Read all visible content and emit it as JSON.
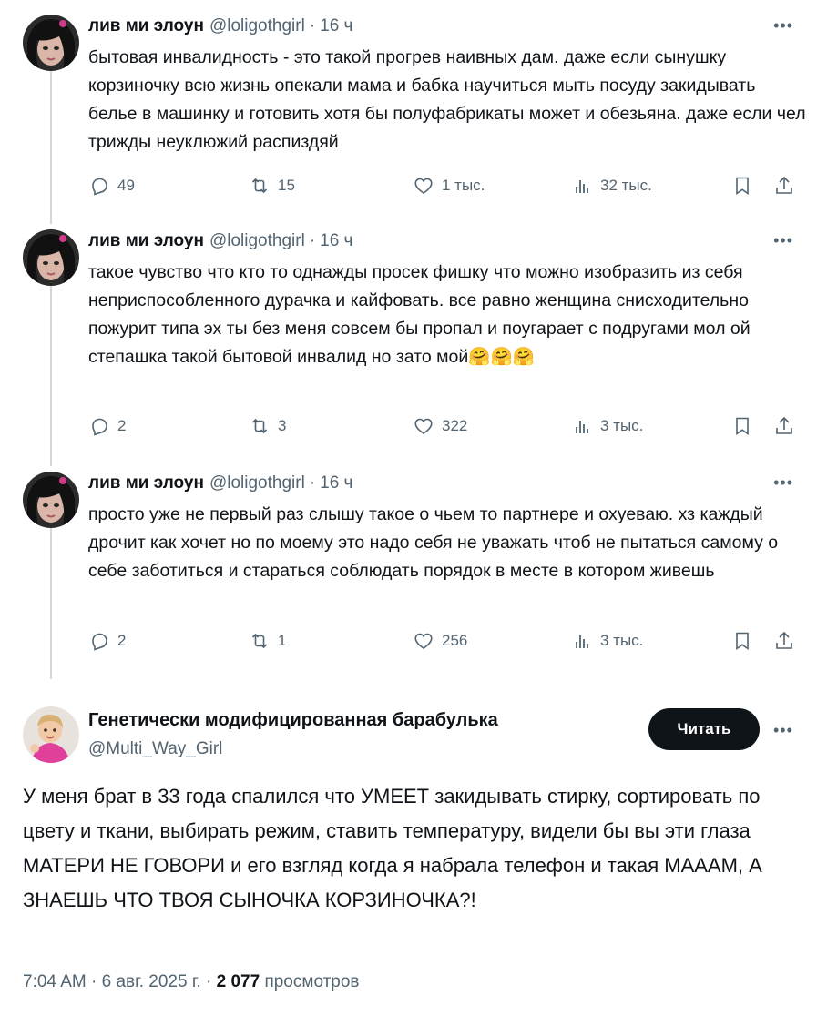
{
  "thread": [
    {
      "name": "лив ми элоун",
      "handle": "@loligothgirl",
      "sep": "·",
      "time": "16 ч",
      "text": "бытовая инвалидность - это такой прогрев наивных дам. даже если сынушку корзиночку всю жизнь опекали мама и бабка научиться мыть посуду закидывать белье в машинку и готовить хотя бы полуфабрикаты может и обезьяна. даже если чел трижды неуклюжий распиздяй",
      "replies": "49",
      "reposts": "15",
      "likes": "1 тыс.",
      "views": "32 тыс."
    },
    {
      "name": "лив ми элоун",
      "handle": "@loligothgirl",
      "sep": "·",
      "time": "16 ч",
      "text": "такое чувство что кто то однажды просек фишку что можно изобразить из себя неприспособленного дурачка и кайфовать. все равно женщина снисходительно пожурит типа эх ты без меня совсем бы пропал и поугарает с подругами мол ой степашка такой бытовой инвалид но зато мой🤗🤗🤗",
      "replies": "2",
      "reposts": "3",
      "likes": "322",
      "views": "3 тыс."
    },
    {
      "name": "лив ми элоун",
      "handle": "@loligothgirl",
      "sep": "·",
      "time": "16 ч",
      "text": "просто уже не первый раз слышу такое о чьем то партнере и охуеваю. хз каждый дрочит как хочет но по моему это надо себя не уважать чтоб не пытаться самому о себе заботиться и стараться соблюдать порядок в месте в котором живешь",
      "replies": "2",
      "reposts": "1",
      "likes": "256",
      "views": "3 тыс."
    }
  ],
  "quote": {
    "name": "Генетически модифицированная барабулька",
    "handle": "@Multi_Way_Girl",
    "follow_label": "Читать",
    "text": "У меня брат в 33 года спалился что УМЕЕТ закидывать стирку, сортировать по цвету и ткани, выбирать режим, ставить температуру, видели бы вы эти глаза МАТЕРИ НЕ ГОВОРИ и его взгляд когда я набрала телефон и такая МАААМ, А ЗНАЕШЬ ЧТО ТВОЯ СЫНОЧКА КОРЗИНОЧКА?!",
    "time": "7:04 AM",
    "date": "6 авг. 2025 г.",
    "sep": "·",
    "views_count": "2 077",
    "views_label": "просмотров"
  },
  "icons": {
    "more": "more-horizontal-icon",
    "reply": "reply-icon",
    "repost": "repost-icon",
    "like": "heart-icon",
    "views": "views-bar-chart-icon",
    "bookmark": "bookmark-icon",
    "share": "share-icon"
  }
}
